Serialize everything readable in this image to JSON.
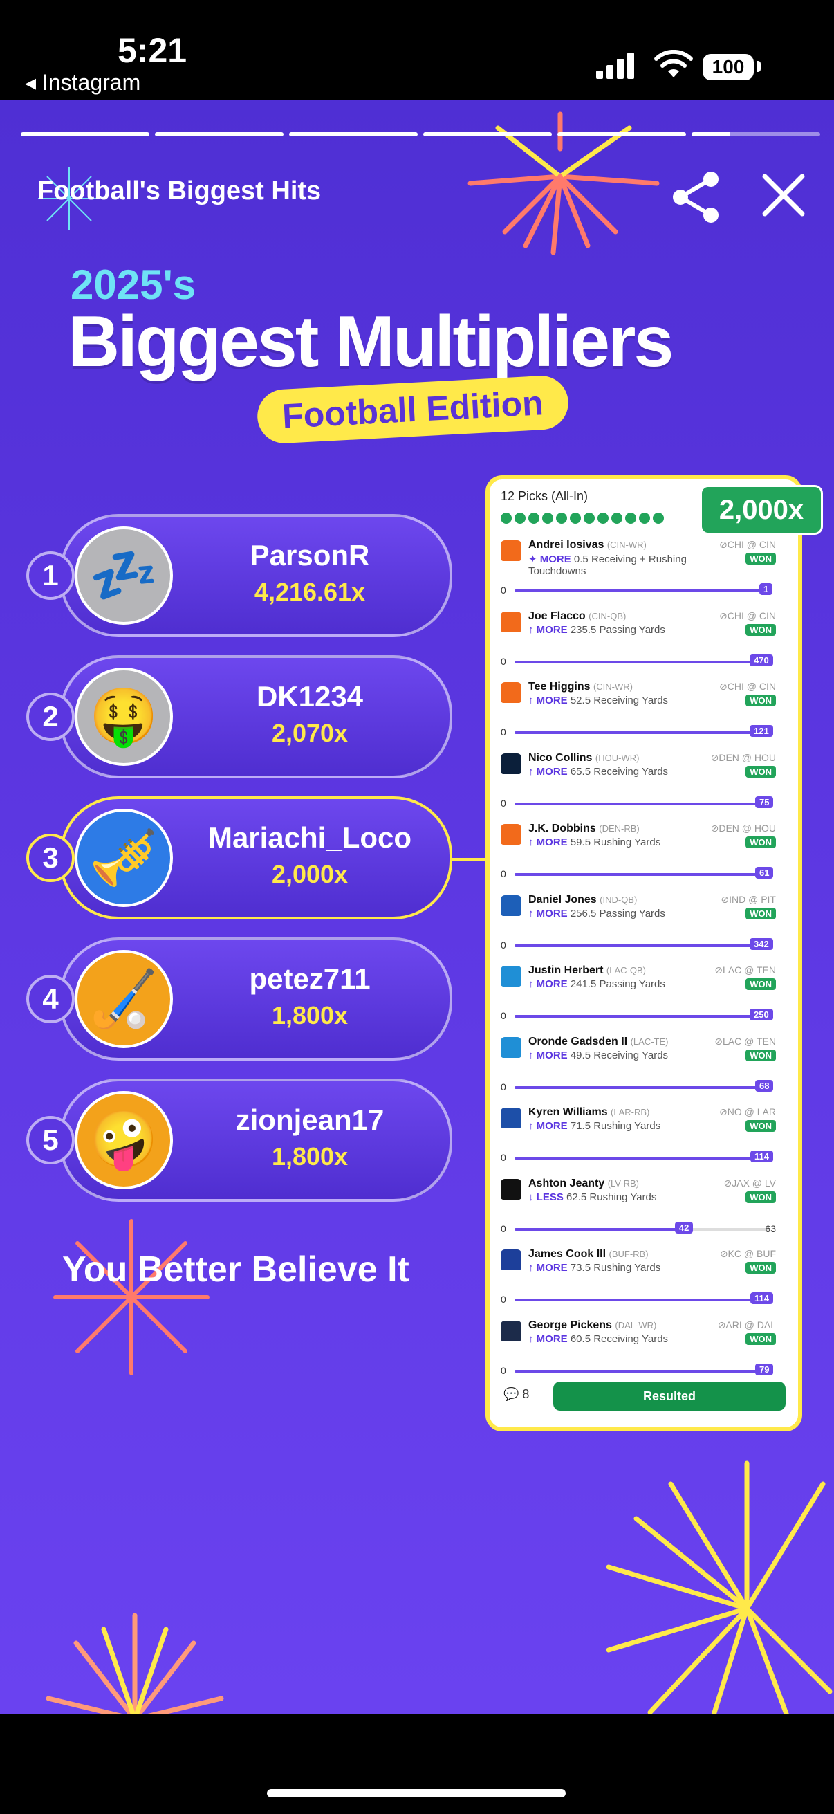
{
  "status_bar": {
    "time": "5:21",
    "back_label": "◂ Instagram",
    "battery": "100"
  },
  "story": {
    "title": "Football's Biggest Hits",
    "year": "2025's",
    "headline": "Biggest Multipliers",
    "edition": "Football Edition",
    "tagline": "You Better Believe It"
  },
  "leaderboard": [
    {
      "rank": "1",
      "name": "ParsonR",
      "multiplier": "4,216.61x",
      "avatar": "sleeping-zzz-icon",
      "glyph": "💤",
      "bg": "#b5b5b8"
    },
    {
      "rank": "2",
      "name": "DK1234",
      "multiplier": "2,070x",
      "avatar": "money-mouth-face-icon",
      "glyph": "🤑",
      "bg": "#b5b5b8"
    },
    {
      "rank": "3",
      "name": "Mariachi_Loco",
      "multiplier": "2,000x",
      "avatar": "trumpet-icon",
      "glyph": "🎺",
      "bg": "#2d7be6"
    },
    {
      "rank": "4",
      "name": "petez711",
      "multiplier": "1,800x",
      "avatar": "field-hockey-icon",
      "glyph": "🏑",
      "bg": "#f3a21b"
    },
    {
      "rank": "5",
      "name": "zionjean17",
      "multiplier": "1,800x",
      "avatar": "zany-face-icon",
      "glyph": "🤪",
      "bg": "#f3a21b"
    }
  ],
  "card": {
    "header": "12 Picks (All-In)",
    "multiplier": "2,000x",
    "picks": [
      {
        "player": "Andrei Iosivas",
        "pos": "(CIN-WR)",
        "dir": "✦ MORE",
        "line": "0.5 Receiving + Rushing Touchdowns",
        "game": "⊘CHI @ CIN",
        "result": "WON",
        "zero": "0",
        "actual": "1",
        "progress": 1.0,
        "target": "",
        "color": "#f26a1b"
      },
      {
        "player": "Joe Flacco",
        "pos": "(CIN-QB)",
        "dir": "↑ MORE",
        "line": "235.5 Passing Yards",
        "game": "⊘CHI @ CIN",
        "result": "WON",
        "zero": "0",
        "actual": "470",
        "progress": 1.0,
        "target": "",
        "color": "#f26a1b"
      },
      {
        "player": "Tee Higgins",
        "pos": "(CIN-WR)",
        "dir": "↑ MORE",
        "line": "52.5 Receiving Yards",
        "game": "⊘CHI @ CIN",
        "result": "WON",
        "zero": "0",
        "actual": "121",
        "progress": 1.0,
        "target": "",
        "color": "#f26a1b"
      },
      {
        "player": "Nico Collins",
        "pos": "(HOU-WR)",
        "dir": "↑ MORE",
        "line": "65.5 Receiving Yards",
        "game": "⊘DEN @ HOU",
        "result": "WON",
        "zero": "0",
        "actual": "75",
        "progress": 1.0,
        "target": "",
        "color": "#0b1f3a"
      },
      {
        "player": "J.K. Dobbins",
        "pos": "(DEN-RB)",
        "dir": "↑ MORE",
        "line": "59.5 Rushing Yards",
        "game": "⊘DEN @ HOU",
        "result": "WON",
        "zero": "0",
        "actual": "61",
        "progress": 1.0,
        "target": "",
        "color": "#f26a1b"
      },
      {
        "player": "Daniel Jones",
        "pos": "(IND-QB)",
        "dir": "↑ MORE",
        "line": "256.5 Passing Yards",
        "game": "⊘IND @ PIT",
        "result": "WON",
        "zero": "0",
        "actual": "342",
        "progress": 1.0,
        "target": "",
        "color": "#1d5fb8"
      },
      {
        "player": "Justin Herbert",
        "pos": "(LAC-QB)",
        "dir": "↑ MORE",
        "line": "241.5 Passing Yards",
        "game": "⊘LAC @ TEN",
        "result": "WON",
        "zero": "0",
        "actual": "250",
        "progress": 1.0,
        "target": "",
        "color": "#1f8fd6"
      },
      {
        "player": "Oronde Gadsden II",
        "pos": "(LAC-TE)",
        "dir": "↑ MORE",
        "line": "49.5 Receiving Yards",
        "game": "⊘LAC @ TEN",
        "result": "WON",
        "zero": "0",
        "actual": "68",
        "progress": 1.0,
        "target": "",
        "color": "#1f8fd6"
      },
      {
        "player": "Kyren Williams",
        "pos": "(LAR-RB)",
        "dir": "↑ MORE",
        "line": "71.5 Rushing Yards",
        "game": "⊘NO @ LAR",
        "result": "WON",
        "zero": "0",
        "actual": "114",
        "progress": 1.0,
        "target": "",
        "color": "#1d4fa8"
      },
      {
        "player": "Ashton Jeanty",
        "pos": "(LV-RB)",
        "dir": "↓ LESS",
        "line": "62.5 Rushing Yards",
        "game": "⊘JAX @ LV",
        "result": "WON",
        "zero": "0",
        "actual": "42",
        "progress": 0.67,
        "target": "63",
        "color": "#111111"
      },
      {
        "player": "James Cook III",
        "pos": "(BUF-RB)",
        "dir": "↑ MORE",
        "line": "73.5 Rushing Yards",
        "game": "⊘KC @ BUF",
        "result": "WON",
        "zero": "0",
        "actual": "114",
        "progress": 1.0,
        "target": "",
        "color": "#1d3f9a"
      },
      {
        "player": "George Pickens",
        "pos": "(DAL-WR)",
        "dir": "↑ MORE",
        "line": "60.5 Receiving Yards",
        "game": "⊘ARI @ DAL",
        "result": "WON",
        "zero": "0",
        "actual": "79",
        "progress": 1.0,
        "target": "",
        "color": "#1c2b4a"
      }
    ],
    "comment_count": "8",
    "status_button": "Resulted"
  },
  "colors": {
    "accent_yellow": "#ffe94a",
    "won_green": "#22a45a",
    "purple": "#5b36e0"
  }
}
